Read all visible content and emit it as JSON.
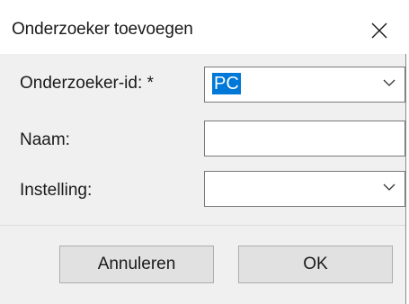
{
  "dialog": {
    "title": "Onderzoeker toevoegen"
  },
  "form": {
    "researcher_id_label": "Onderzoeker-id: *",
    "researcher_id_value": "PC",
    "name_label": "Naam:",
    "name_value": "",
    "institution_label": "Instelling:",
    "institution_value": ""
  },
  "buttons": {
    "cancel_label": "Annuleren",
    "ok_label": "OK"
  },
  "icons": {
    "close": "close-icon",
    "dropdown": "chevron-down-icon"
  },
  "colors": {
    "selection": "#0078d7",
    "dialog_background": "#f0f0f0"
  }
}
